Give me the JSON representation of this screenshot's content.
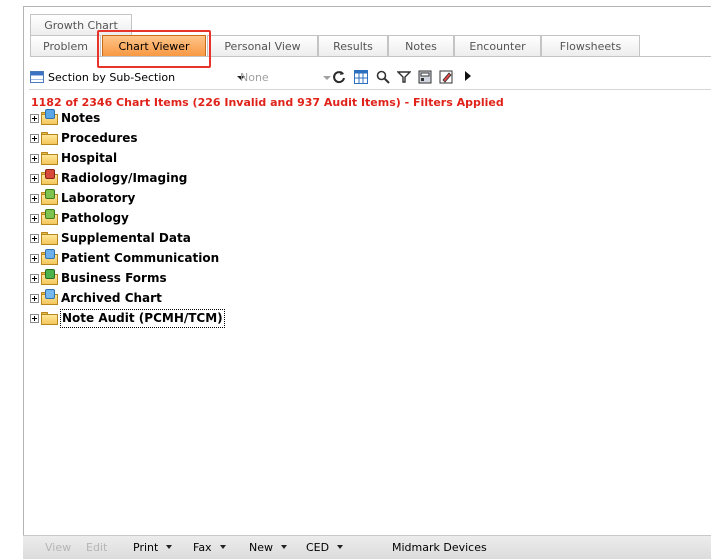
{
  "tabs_row1": [
    {
      "label": "Growth Chart"
    }
  ],
  "tabs_row2": [
    {
      "label": "Problem"
    },
    {
      "label": "Chart Viewer"
    },
    {
      "label": "Personal View"
    },
    {
      "label": "Results"
    },
    {
      "label": "Notes"
    },
    {
      "label": "Encounter"
    },
    {
      "label": "Flowsheets"
    }
  ],
  "toolbar": {
    "view_mode": "Section by Sub-Section",
    "filter_value": "None",
    "icons": [
      "refresh-icon",
      "grid-icon",
      "search-icon",
      "filter-icon",
      "print-icon",
      "edit-icon",
      "play-icon"
    ]
  },
  "status_text": "1182 of 2346 Chart Items (226 Invalid and 937 Audit Items) - Filters Applied",
  "tree": [
    {
      "label": "Notes",
      "badge": "notes"
    },
    {
      "label": "Procedures",
      "badge": ""
    },
    {
      "label": "Hospital",
      "badge": ""
    },
    {
      "label": "Radiology/Imaging",
      "badge": "radio"
    },
    {
      "label": "Laboratory",
      "badge": "lab"
    },
    {
      "label": "Pathology",
      "badge": "lab"
    },
    {
      "label": "Supplemental Data",
      "badge": ""
    },
    {
      "label": "Patient Communication",
      "badge": "comm"
    },
    {
      "label": "Business Forms",
      "badge": "biz"
    },
    {
      "label": "Archived Chart",
      "badge": "arch"
    },
    {
      "label": "Note Audit (PCMH/TCM)",
      "badge": ""
    }
  ],
  "bottom_bar": {
    "view": "View",
    "edit": "Edit",
    "print": "Print",
    "fax": "Fax",
    "new": "New",
    "ced": "CED",
    "midmark": "Midmark Devices"
  }
}
